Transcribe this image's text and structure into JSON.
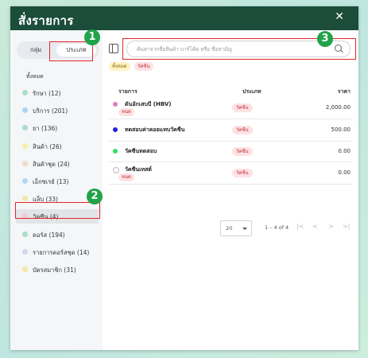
{
  "header": {
    "title": "สั่งรายการ",
    "close_icon": "close-icon"
  },
  "sidebar": {
    "toggle": {
      "group_label": "กลุ่ม",
      "type_label": "ประเภท"
    },
    "all_label": "ทั้งหมด",
    "categories": [
      {
        "label": "รักษา (12)",
        "color": "#a8dfc9"
      },
      {
        "label": "บริการ (201)",
        "color": "#a9d5f0"
      },
      {
        "label": "ยา (136)",
        "color": "#a8dfc9"
      },
      {
        "label": "สินค้า (26)",
        "color": "#f4f0a3"
      },
      {
        "label": "สินค้าชุด (24)",
        "color": "#f5d9c1"
      },
      {
        "label": "เอ็กซเรย์ (13)",
        "color": "#b4d8f0"
      },
      {
        "label": "แล็บ (33)",
        "color": "#f0e7a8"
      },
      {
        "label": "วัคซีน (4)",
        "color": "#f6c8d0"
      },
      {
        "label": "คอร์ส (194)",
        "color": "#a8dfc9"
      },
      {
        "label": "รายการคอร์สชุด (14)",
        "color": "#d8d4f2"
      },
      {
        "label": "บัตรสมาชิก (31)",
        "color": "#f3e9a6"
      }
    ]
  },
  "search": {
    "placeholder": "ค้นหาจากชื่อสินค้า บาร์โค้ด หรือ ชื่อสามัญ",
    "icon": "search-icon"
  },
  "chips": {
    "all": "ทั้งหมด",
    "filter": "วัคซีน"
  },
  "table": {
    "headers": {
      "item": "รายการ",
      "type": "ประเภท",
      "price": "ราคา"
    },
    "rows": [
      {
        "name": "ดันอักเสบบี (HBV)",
        "unit": "หนด",
        "category": "วัคซีน",
        "price": "2,000.00",
        "dot_color": "#e27fb9"
      },
      {
        "name": "ทดสอบค่าคอยแทบวัคซีน",
        "unit": "",
        "category": "วัคซีน",
        "price": "500.00",
        "dot_color": "#2324d6"
      },
      {
        "name": "วัคซีนทดสอบ",
        "unit": "",
        "category": "วัคซีน",
        "price": "0.00",
        "dot_color": "#35e05a"
      },
      {
        "name": "วัคซีนเทสต์",
        "unit": "หนด",
        "category": "วัคซีน",
        "price": "0.00",
        "dot_color": "#ffffff"
      }
    ]
  },
  "pager": {
    "page_size": "20",
    "range": "1 – 4 of 4",
    "first": "|<",
    "prev": "<",
    "next": ">",
    "last": ">|"
  },
  "annotations": {
    "one": "1",
    "two": "2",
    "three": "3",
    "color": "#e3262b",
    "badge_color": "#22a34a"
  }
}
